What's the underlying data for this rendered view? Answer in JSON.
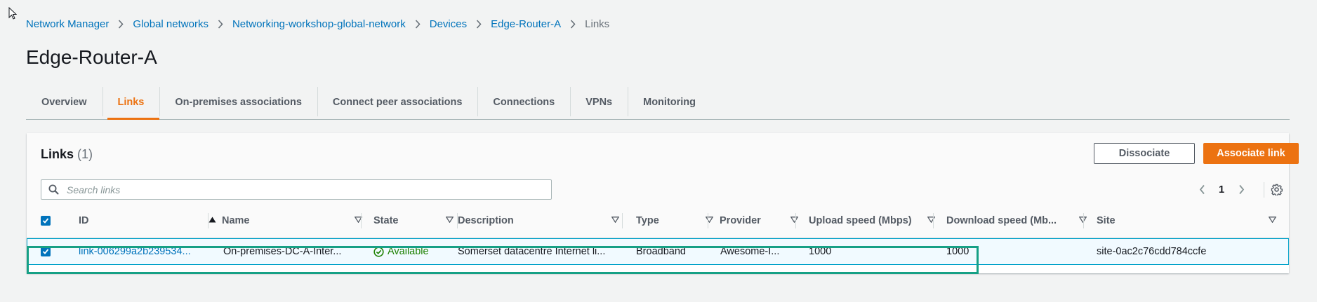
{
  "breadcrumb": {
    "items": [
      "Network Manager",
      "Global networks",
      "Networking-workshop-global-network",
      "Devices",
      "Edge-Router-A"
    ],
    "current": "Links"
  },
  "page": {
    "title": "Edge-Router-A"
  },
  "tabs": [
    {
      "label": "Overview",
      "active": false
    },
    {
      "label": "Links",
      "active": true
    },
    {
      "label": "On-premises associations",
      "active": false
    },
    {
      "label": "Connect peer associations",
      "active": false
    },
    {
      "label": "Connections",
      "active": false
    },
    {
      "label": "VPNs",
      "active": false
    },
    {
      "label": "Monitoring",
      "active": false
    }
  ],
  "links_panel": {
    "title": "Links",
    "count": "(1)",
    "dissociate_label": "Dissociate",
    "associate_label": "Associate link",
    "search_placeholder": "Search links",
    "page_number": "1"
  },
  "table": {
    "columns": [
      "ID",
      "Name",
      "State",
      "Description",
      "Type",
      "Provider",
      "Upload speed (Mbps)",
      "Download speed (Mb...",
      "Site"
    ],
    "rows": [
      {
        "id": "link-006299a2b239534...",
        "name": "On-premises-DC-A-Inter...",
        "state": "Available",
        "description": "Somerset datacentre Internet li...",
        "type": "Broadband",
        "provider": "Awesome-I...",
        "upload": "1000",
        "download": "1000",
        "site": "site-0ac2c76cdd784ccfe"
      }
    ]
  },
  "colors": {
    "accent": "#ec7211",
    "link": "#0073bb",
    "success": "#1d8102",
    "selection_border": "#00a1c9",
    "highlight_box": "#16a085"
  },
  "icons": [
    "cursor-pointer-icon",
    "chevron-right-icon",
    "search-icon",
    "chevron-left-icon",
    "gear-icon",
    "sort-ascending-icon",
    "sort-caret-down-icon",
    "check-circle-icon",
    "checkbox-checked-icon"
  ]
}
